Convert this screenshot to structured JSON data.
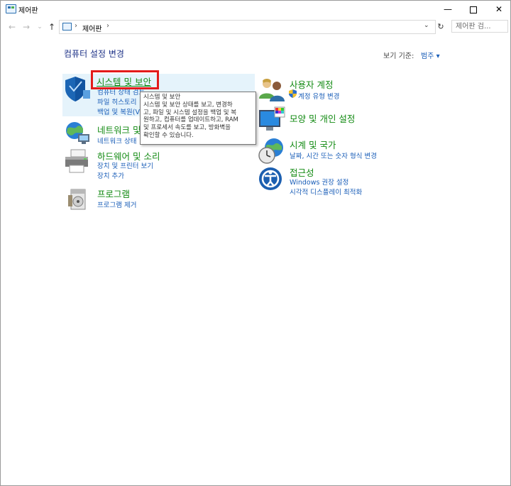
{
  "window": {
    "title": "제어판"
  },
  "titlebar": {
    "minimize": "—",
    "close": "✕"
  },
  "nav": {
    "back": "←",
    "forward": "→",
    "recent": "⌄",
    "up": "↑"
  },
  "address": {
    "separator": "›",
    "path": "제어판",
    "dropdown": "⌄",
    "refresh": "↻"
  },
  "search": {
    "placeholder": "제어판 검..."
  },
  "main": {
    "heading": "컴퓨터 설정 변경",
    "view_by_label": "보기 기준:",
    "view_by_value": "범주 ▾"
  },
  "categories": {
    "system": {
      "title": "시스템 및 보안",
      "links": [
        "컴퓨터 상태 검토",
        "파일 히스토리로 파일 백업 복사본 저장",
        "백업 및 복원(Windows 7)"
      ],
      "links_visible": [
        "컴퓨터 상태 검토",
        "파일 히스토리",
        "백업 및 복원(V"
      ]
    },
    "network": {
      "title": "네트워크 및",
      "links": [
        "네트워크 상태"
      ]
    },
    "hardware": {
      "title": "하드웨어 및 소리",
      "links": [
        "장치 및 프린터 보기",
        "장치 추가"
      ]
    },
    "programs": {
      "title": "프로그램",
      "links": [
        "프로그램 제거"
      ]
    },
    "user": {
      "title": "사용자 계정",
      "links": [
        "계정 유형 변경"
      ]
    },
    "appearance": {
      "title": "모양 및 개인 설정",
      "links": []
    },
    "clock": {
      "title": "시계 및 국가",
      "links": [
        "날짜, 시간 또는 숫자 형식 변경"
      ]
    },
    "access": {
      "title": "접근성",
      "links": [
        "Windows 권장 설정",
        "시각적 디스플레이 최적화"
      ]
    }
  },
  "tooltip": {
    "title": "시스템 및 보안",
    "lines": [
      "시스템 및 보안 상태를 보고, 변경하",
      "고, 파일 및 시스템 설정을 백업 및 복",
      "원하고, 컴퓨터를 업데이트하고, RAM",
      "및 프로세서 속도를 보고, 방화벽을",
      "확인할 수 있습니다."
    ]
  },
  "colors": {
    "accent_link": "#1a5eb8",
    "category_green": "#128a12",
    "heading_blue": "#1e3287",
    "highlight_red": "#e31b1b",
    "hover_bg": "#e5f3fb"
  }
}
